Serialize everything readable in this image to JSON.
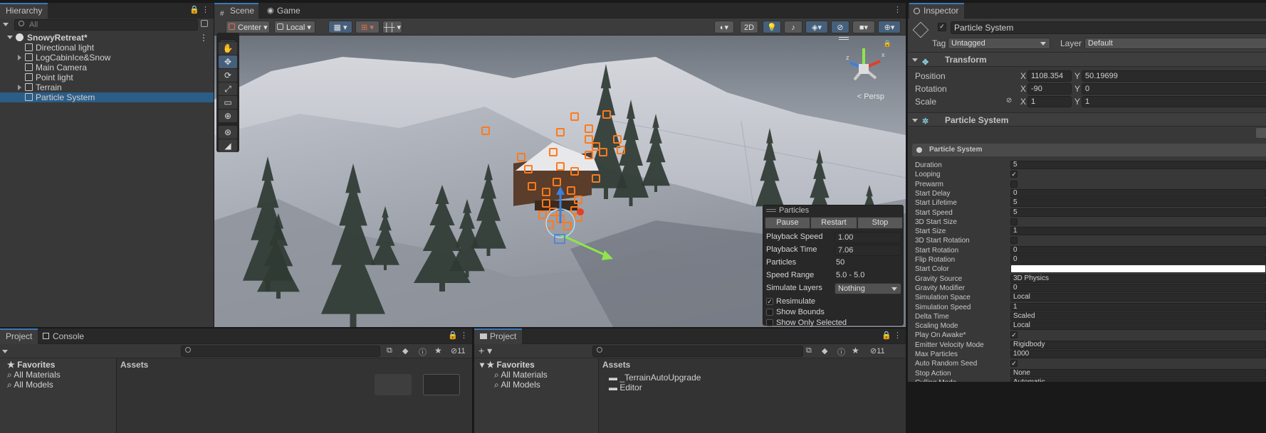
{
  "hierarchy": {
    "tab": "Hierarchy",
    "search_placeholder": "All",
    "scene": "SnowyRetreat*",
    "items": [
      {
        "label": "Directional light",
        "expandable": false,
        "selected": false
      },
      {
        "label": "LogCabinIce&Snow",
        "expandable": true,
        "selected": false
      },
      {
        "label": "Main Camera",
        "expandable": false,
        "selected": false
      },
      {
        "label": "Point light",
        "expandable": false,
        "selected": false
      },
      {
        "label": "Terrain",
        "expandable": true,
        "selected": false
      },
      {
        "label": "Particle System",
        "expandable": false,
        "selected": true
      }
    ]
  },
  "scene_view": {
    "tabs": [
      "Scene",
      "Game"
    ],
    "active_tab": "Scene",
    "pivot_label": "Center",
    "space_label": "Local",
    "mode_2d": "2D",
    "persp_label": "Persp",
    "gizmo_axes": [
      "z",
      "x"
    ],
    "overlay": {
      "title": "Particles",
      "buttons": [
        "Pause",
        "Restart",
        "Stop"
      ],
      "rows": {
        "playback_speed_label": "Playback Speed",
        "playback_speed": "1.00",
        "playback_time_label": "Playback Time",
        "playback_time": "7.06",
        "particles_label": "Particles",
        "particles": "50",
        "speed_range_label": "Speed Range",
        "speed_range": "5.0 - 5.0",
        "simulate_layers_label": "Simulate Layers",
        "simulate_layers": "Nothing"
      },
      "checks": [
        {
          "label": "Resimulate",
          "checked": true
        },
        {
          "label": "Show Bounds",
          "checked": false
        },
        {
          "label": "Show Only Selected",
          "checked": false
        }
      ]
    }
  },
  "inspector": {
    "tab": "Inspector",
    "object_name": "Particle System",
    "tag_label": "Tag",
    "tag_value": "Untagged",
    "layer_label": "Layer",
    "layer_value": "Default",
    "transform": {
      "title": "Transform",
      "position_label": "Position",
      "pos_x": "1108.354",
      "pos_y": "50.19699",
      "rotation_label": "Rotation",
      "rot_x": "-90",
      "rot_y": "0",
      "scale_label": "Scale",
      "scale_x": "1",
      "scale_y": "1",
      "x": "X",
      "y": "Y"
    },
    "component_title": "Particle System",
    "module_title": "Particle System",
    "props": [
      {
        "label": "Duration",
        "type": "value",
        "value": "5"
      },
      {
        "label": "Looping",
        "type": "check",
        "value": "✓"
      },
      {
        "label": "Prewarm",
        "type": "check",
        "value": ""
      },
      {
        "label": "Start Delay",
        "type": "value",
        "value": "0"
      },
      {
        "label": "Start Lifetime",
        "type": "value",
        "value": "5"
      },
      {
        "label": "Start Speed",
        "type": "value",
        "value": "5"
      },
      {
        "label": "3D Start Size",
        "type": "check",
        "value": ""
      },
      {
        "label": "Start Size",
        "type": "value",
        "value": "1"
      },
      {
        "label": "3D Start Rotation",
        "type": "check",
        "value": ""
      },
      {
        "label": "Start Rotation",
        "type": "value",
        "value": "0"
      },
      {
        "label": "Flip Rotation",
        "type": "value",
        "value": "0"
      },
      {
        "label": "Start Color",
        "type": "color",
        "value": ""
      },
      {
        "label": "Gravity Source",
        "type": "value",
        "value": "3D Physics"
      },
      {
        "label": "Gravity Modifier",
        "type": "value",
        "value": "0"
      },
      {
        "label": "Simulation Space",
        "type": "value",
        "value": "Local"
      },
      {
        "label": "Simulation Speed",
        "type": "value",
        "value": "1"
      },
      {
        "label": "Delta Time",
        "type": "value",
        "value": "Scaled"
      },
      {
        "label": "Scaling Mode",
        "type": "value",
        "value": "Local"
      },
      {
        "label": "Play On Awake*",
        "type": "check",
        "value": "✓"
      },
      {
        "label": "Emitter Velocity Mode",
        "type": "value",
        "value": "Rigidbody"
      },
      {
        "label": "Max Particles",
        "type": "value",
        "value": "1000"
      },
      {
        "label": "Auto Random Seed",
        "type": "check",
        "value": "✓"
      },
      {
        "label": "Stop Action",
        "type": "value",
        "value": "None"
      },
      {
        "label": "Culling Mode",
        "type": "value",
        "value": "Automatic"
      }
    ]
  },
  "project_left": {
    "tabs": [
      "Project",
      "Console"
    ],
    "hidden_count": "11",
    "favorites": "Favorites",
    "fav_items": [
      "All Materials",
      "All Models"
    ],
    "assets": "Assets"
  },
  "project_right": {
    "tab": "Project",
    "hidden_count": "11",
    "favorites": "Favorites",
    "fav_items": [
      "All Materials",
      "All Models"
    ],
    "assets": "Assets",
    "asset_items": [
      "_TerrainAutoUpgrade",
      "Editor"
    ]
  },
  "colors": {
    "selection": "#2c5d87",
    "accent": "#3a79bb",
    "particle_gizmo": "#ff7a1a"
  }
}
